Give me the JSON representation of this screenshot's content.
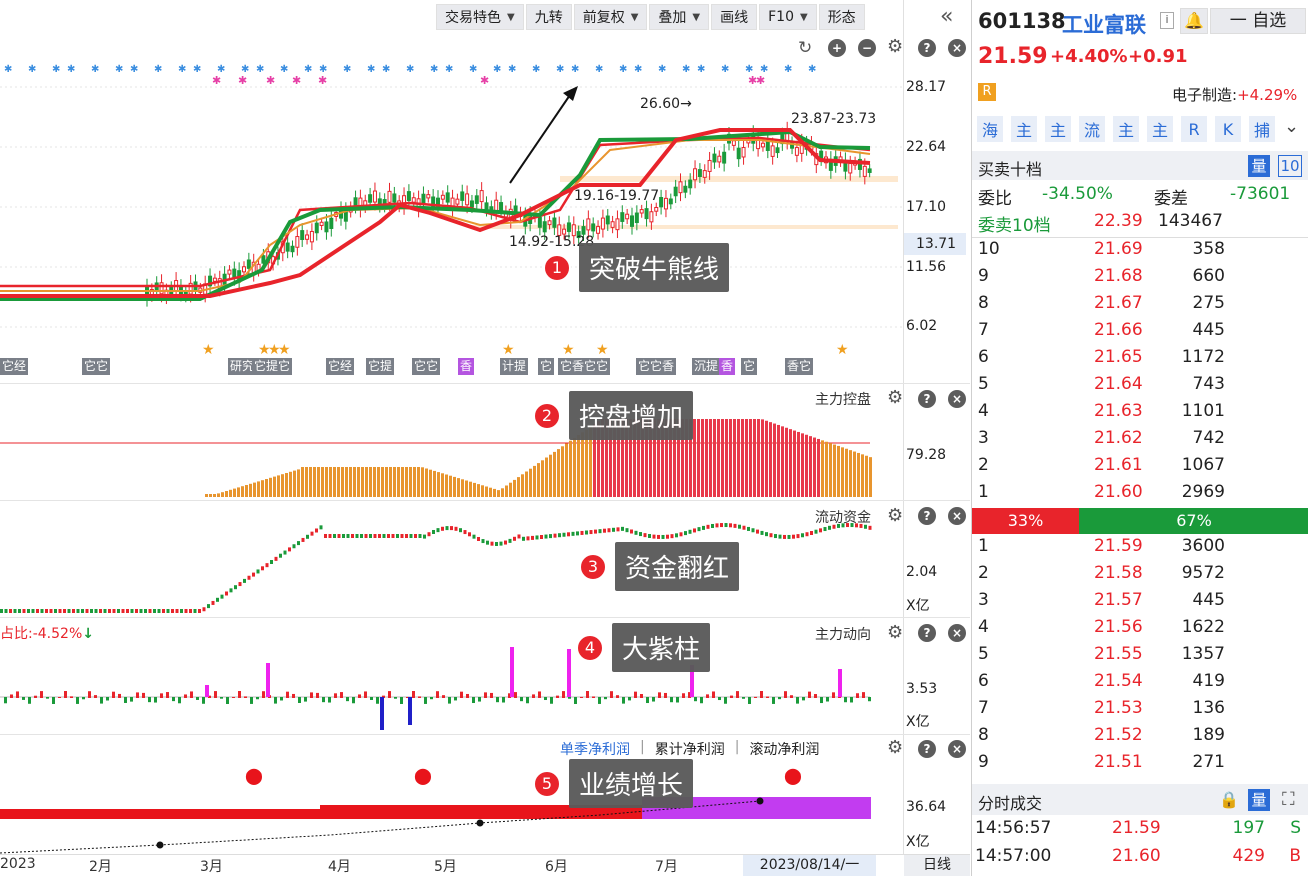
{
  "toolbar": {
    "items": [
      "交易特色",
      "九转",
      "前复权",
      "叠加",
      "画线",
      "F10",
      "形态"
    ],
    "collapse": "«"
  },
  "price_axis": [
    "28.17",
    "22.64",
    "17.10",
    "13.71",
    "11.56",
    "6.02"
  ],
  "chart_annotations": {
    "peak": "26.60→",
    "range_top": "23.87-23.73",
    "range_mid": "19.16-19.77",
    "range_low": "14.92-15.28"
  },
  "event_tags": [
    "它经",
    "它它",
    "研究",
    "它提它",
    "它经",
    "它提",
    "它它",
    "香",
    "计提",
    "它",
    "它香它它",
    "它它香",
    "沉提",
    "香",
    "它",
    "香它"
  ],
  "callouts": [
    {
      "num": "1",
      "text": "突破牛熊线"
    },
    {
      "num": "2",
      "text": "控盘增加"
    },
    {
      "num": "3",
      "text": "资金翻红"
    },
    {
      "num": "4",
      "text": "大紫柱"
    },
    {
      "num": "5",
      "text": "业绩增长"
    }
  ],
  "panels": {
    "control": {
      "title": "主力控盘",
      "value": "79.28"
    },
    "flow": {
      "title": "流动资金",
      "value": "2.04",
      "unit": "X亿"
    },
    "dynamic": {
      "title": "主力动向",
      "value": "3.53",
      "unit": "X亿",
      "ratio": "占比:-4.52%"
    },
    "earnings": {
      "tabs": [
        "单季净利润",
        "累计净利润",
        "滚动净利润"
      ],
      "value": "36.64",
      "unit": "X亿"
    }
  },
  "x_axis": [
    "2023",
    "2月",
    "3月",
    "4月",
    "5月",
    "6月",
    "7月"
  ],
  "date_box": "2023/08/14/一",
  "period_box": "日线",
  "stock": {
    "code": "601138",
    "name": "工业富联",
    "price": "21.59",
    "pct": "+4.40%",
    "chg": "+0.91",
    "watch": "一 自选",
    "badge": "R",
    "sector": "电子制造:",
    "sector_pct": "+4.29%"
  },
  "quick_buttons": [
    "海",
    "主",
    "主",
    "流",
    "主",
    "主",
    "R",
    "K",
    "捕"
  ],
  "orderbook": {
    "title": "买卖十档",
    "qty_btn": "量",
    "ten_btn": "10",
    "webi_label": "委比",
    "webi": "-34.50%",
    "weicha_label": "委差",
    "weicha": "-73601",
    "sell10_label": "委卖10档",
    "sell10_price": "22.39",
    "sell10_vol": "143467",
    "asks": [
      [
        "10",
        "21.69",
        "358"
      ],
      [
        "9",
        "21.68",
        "660"
      ],
      [
        "8",
        "21.67",
        "275"
      ],
      [
        "7",
        "21.66",
        "445"
      ],
      [
        "6",
        "21.65",
        "1172"
      ],
      [
        "5",
        "21.64",
        "743"
      ],
      [
        "4",
        "21.63",
        "1101"
      ],
      [
        "3",
        "21.62",
        "742"
      ],
      [
        "2",
        "21.61",
        "1067"
      ],
      [
        "1",
        "21.60",
        "2969"
      ]
    ],
    "buy_ratio": "33%",
    "sell_ratio": "67%",
    "bids": [
      [
        "1",
        "21.59",
        "3600"
      ],
      [
        "2",
        "21.58",
        "9572"
      ],
      [
        "3",
        "21.57",
        "445"
      ],
      [
        "4",
        "21.56",
        "1622"
      ],
      [
        "5",
        "21.55",
        "1357"
      ],
      [
        "6",
        "21.54",
        "419"
      ],
      [
        "7",
        "21.53",
        "136"
      ],
      [
        "8",
        "21.52",
        "189"
      ],
      [
        "9",
        "21.51",
        "271"
      ]
    ]
  },
  "trades": {
    "title": "分时成交",
    "qty_btn": "量",
    "rows": [
      [
        "14:56:57",
        "21.59",
        "197",
        "S"
      ],
      [
        "14:57:00",
        "21.60",
        "429",
        "B"
      ]
    ]
  },
  "colors": {
    "red": "#e8242b",
    "green": "#1a9a3a",
    "blue": "#2b6cd6",
    "orange": "#e8952e",
    "purple": "#c23cf0"
  }
}
